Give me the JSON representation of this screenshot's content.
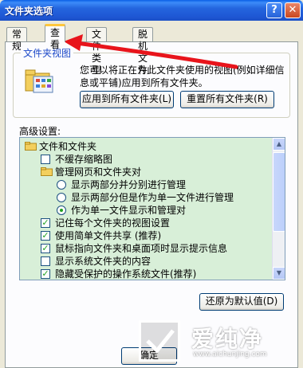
{
  "window": {
    "title": "文件夹选项",
    "help_glyph": "?",
    "close_glyph": "✕"
  },
  "tabs": [
    {
      "label": "常规"
    },
    {
      "label": "查看"
    },
    {
      "label": "文件类型"
    },
    {
      "label": "脱机文件"
    }
  ],
  "folder_views": {
    "label": "文件夹视图",
    "description": "您可以将正在为此文件夹使用的视图(例如详细信息或平铺)应用到所有文件夹。",
    "apply_label": "应用到所有文件夹(L)",
    "reset_label": "重置所有文件夹(R)"
  },
  "advanced": {
    "label": "高级设置:",
    "items": [
      {
        "type": "folder",
        "indent": 0,
        "label": "文件和文件夹"
      },
      {
        "type": "checkbox",
        "indent": 1,
        "label": "不缓存缩略图",
        "checked": false
      },
      {
        "type": "folder",
        "indent": 1,
        "label": "管理网页和文件夹对"
      },
      {
        "type": "radio",
        "indent": 2,
        "label": "显示两部分并分别进行管理",
        "checked": false
      },
      {
        "type": "radio",
        "indent": 2,
        "label": "显示两部分但是作为单一文件进行管理",
        "checked": false
      },
      {
        "type": "radio",
        "indent": 2,
        "label": "作为单一文件显示和管理对",
        "checked": true
      },
      {
        "type": "checkbox",
        "indent": 1,
        "label": "记住每个文件夹的视图设置",
        "checked": true
      },
      {
        "type": "checkbox",
        "indent": 1,
        "label": "使用简单文件共享 (推荐)",
        "checked": true
      },
      {
        "type": "checkbox",
        "indent": 1,
        "label": "鼠标指向文件夹和桌面项时显示提示信息",
        "checked": true
      },
      {
        "type": "checkbox",
        "indent": 1,
        "label": "显示系统文件夹的内容",
        "checked": false
      },
      {
        "type": "checkbox",
        "indent": 1,
        "label": "隐藏受保护的操作系统文件(推荐)",
        "checked": true
      }
    ],
    "restore_label": "还原为默认值(D)"
  },
  "footer": {
    "ok_label": "确定"
  },
  "watermark": {
    "text": "爱纯净",
    "url": "www.aichunjing.com"
  },
  "colors": {
    "titlebar": "#2465de",
    "list_bg": "#d8efd8",
    "annotation_arrow": "#e8141b"
  }
}
